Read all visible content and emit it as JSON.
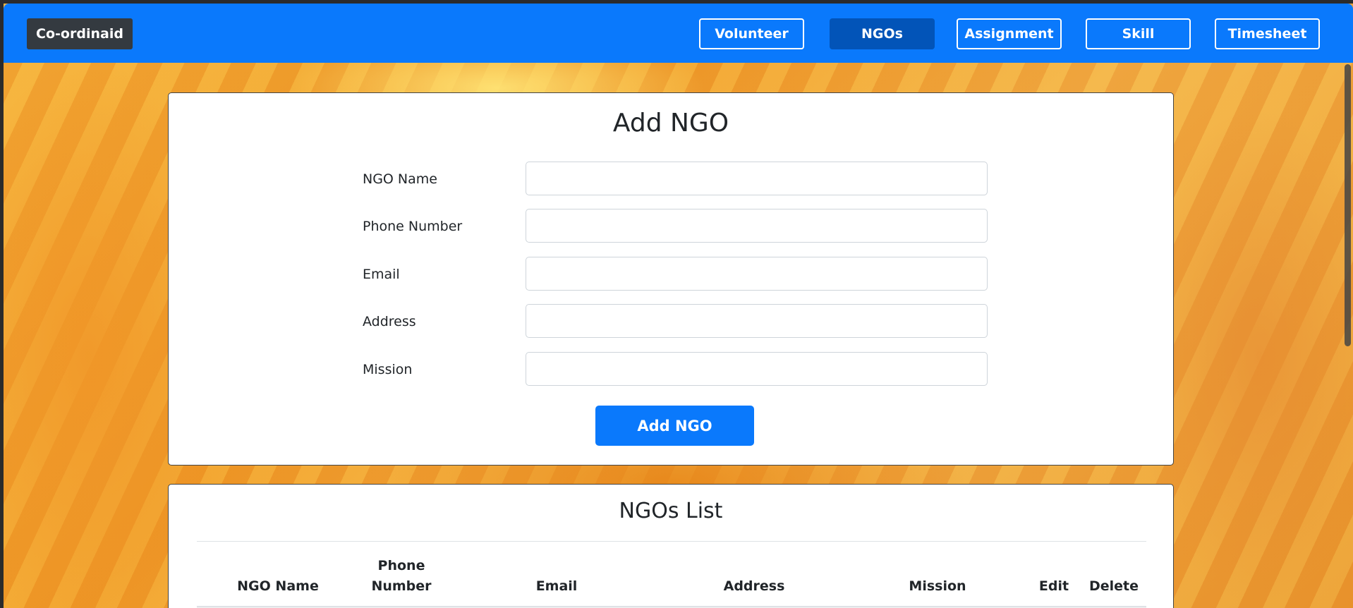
{
  "navbar": {
    "brand": "Co-ordinaid",
    "items": [
      {
        "label": "Volunteer",
        "active": false
      },
      {
        "label": "NGOs",
        "active": true
      },
      {
        "label": "Assignment",
        "active": false
      },
      {
        "label": "Skill",
        "active": false
      },
      {
        "label": "Timesheet",
        "active": false
      }
    ]
  },
  "add_form": {
    "title": "Add NGO",
    "fields": [
      {
        "label": "NGO Name",
        "value": "",
        "placeholder": ""
      },
      {
        "label": "Phone Number",
        "value": "",
        "placeholder": ""
      },
      {
        "label": "Email",
        "value": "",
        "placeholder": ""
      },
      {
        "label": "Address",
        "value": "",
        "placeholder": ""
      },
      {
        "label": "Mission",
        "value": "",
        "placeholder": ""
      }
    ],
    "submit_label": "Add NGO"
  },
  "list": {
    "title": "NGOs List",
    "columns": [
      "NGO Name",
      "Phone Number",
      "Email",
      "Address",
      "Mission",
      "Edit",
      "Delete"
    ],
    "rows": []
  },
  "colors": {
    "primary": "#0a79fc",
    "nav_active": "#0254b8",
    "brand_bg": "#343a40"
  }
}
